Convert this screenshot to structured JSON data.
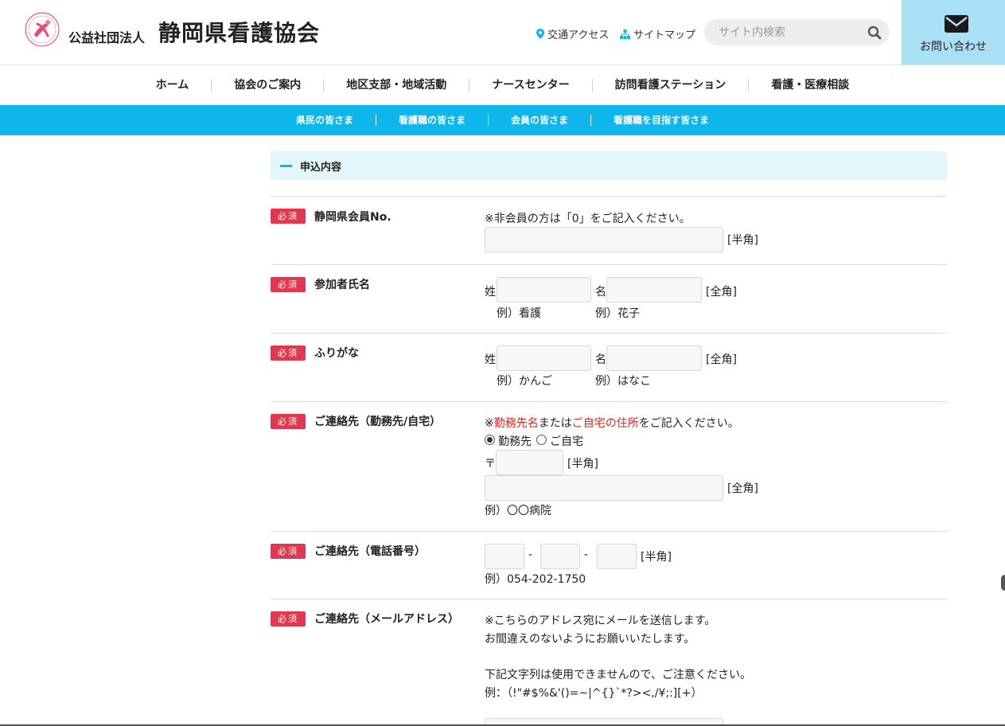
{
  "header": {
    "org_small": "公益社団法人",
    "org_big": "静岡県看護協会",
    "access": "交通アクセス",
    "sitemap": "サイトマップ",
    "search_placeholder": "サイト内検索",
    "contact": "お問い合わせ"
  },
  "main_nav": [
    "ホーム",
    "協会のご案内",
    "地区支部・地域活動",
    "ナースセンター",
    "訪問看護ステーション",
    "看護・医療相談"
  ],
  "sub_nav": [
    "県民の皆さま",
    "看護職の皆さま",
    "会員の皆さま",
    "看護職を目指す皆さま"
  ],
  "section": {
    "title": "申込内容"
  },
  "required_badge": "必須",
  "form": {
    "member_no": {
      "label": "静岡県会員No.",
      "note": "※非会員の方は「0」をご記入ください。",
      "hint": "[半角]"
    },
    "name": {
      "label": "参加者氏名",
      "sei": "姓",
      "mei": "名",
      "hint": "[全角]",
      "ex_sei": "例）看護",
      "ex_mei": "例）花子"
    },
    "kana": {
      "label": "ふりがな",
      "sei": "姓",
      "mei": "名",
      "hint": "[全角]",
      "ex_sei": "例）かんご",
      "ex_mei": "例）はなこ"
    },
    "address": {
      "label": "ご連絡先（勤務先/自宅）",
      "note_pre": "※",
      "note_red1": "勤務先名",
      "note_mid": "または",
      "note_red2": "ご自宅の住所",
      "note_post": "をご記入ください。",
      "opt_work": "勤務先",
      "opt_home": "ご自宅",
      "selected": "勤務先",
      "zip_mark": "〒",
      "zip_hint": "[半角]",
      "addr_hint": "[全角]",
      "example": "例）〇〇病院"
    },
    "phone": {
      "label": "ご連絡先（電話番号）",
      "sep": "-",
      "hint": "[半角]",
      "example": "例）054-202-1750"
    },
    "email": {
      "label": "ご連絡先（メールアドレス）",
      "note1": "※こちらのアドレス宛にメールを送信します。",
      "note2": "お間違えのないようにお願いいたします。",
      "note3": "下記文字列は使用できませんので、ご注意ください。",
      "note4": "例：（!\"#$%&'()=~|^{}`*?><,/¥;:][+）"
    }
  },
  "colors": {
    "accent": "#0fb6ec",
    "required": "#e0394f",
    "contact_bg": "#abe1f7",
    "section_bg": "#e3f6fc"
  }
}
